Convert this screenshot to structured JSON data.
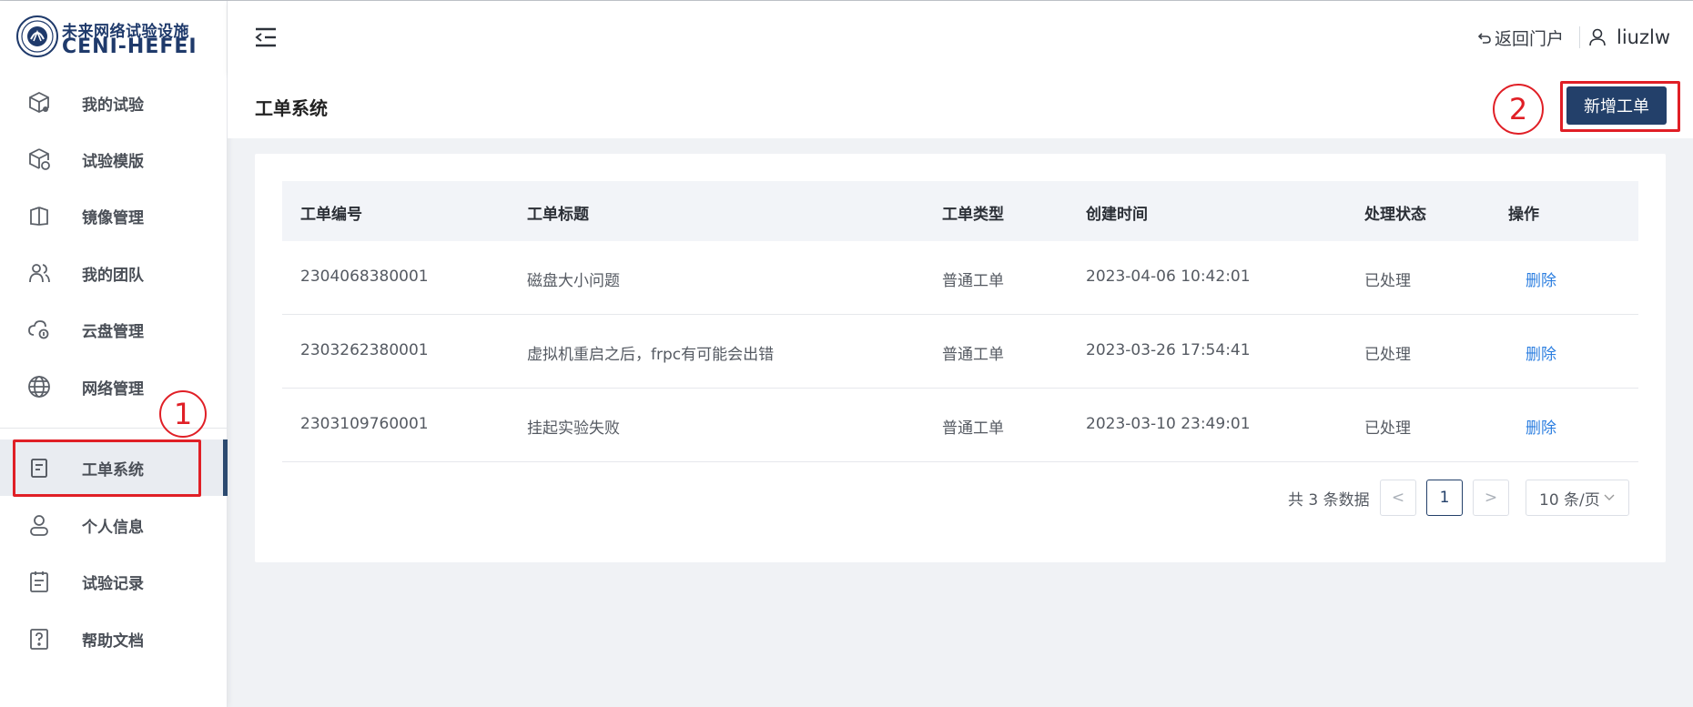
{
  "logo": {
    "name_cn": "未来网络试验设施",
    "name_en": "CENI-HEFEI"
  },
  "sidebar": {
    "items": [
      {
        "label": "我的试验",
        "icon": "cube-box-icon"
      },
      {
        "label": "试验模版",
        "icon": "cube-template-icon"
      },
      {
        "label": "镜像管理",
        "icon": "mirror-book-icon"
      },
      {
        "label": "我的团队",
        "icon": "team-icon"
      },
      {
        "label": "云盘管理",
        "icon": "cloud-disk-icon"
      },
      {
        "label": "网络管理",
        "icon": "globe-icon"
      },
      {
        "label": "工单系统",
        "icon": "ticket-doc-icon",
        "active": true
      },
      {
        "label": "个人信息",
        "icon": "user-icon"
      },
      {
        "label": "试验记录",
        "icon": "clipboard-icon"
      },
      {
        "label": "帮助文档",
        "icon": "help-doc-icon"
      }
    ]
  },
  "header": {
    "back_portal": "返回门户",
    "username": "liuzlw"
  },
  "page": {
    "title": "工单系统",
    "new_button": "新增工单"
  },
  "table": {
    "columns": [
      "工单编号",
      "工单标题",
      "工单类型",
      "创建时间",
      "处理状态",
      "操作"
    ],
    "rows": [
      {
        "id": "2304068380001",
        "title": "磁盘大小问题",
        "type": "普通工单",
        "created": "2023-04-06 10:42:01",
        "status": "已处理",
        "action": "删除"
      },
      {
        "id": "2303262380001",
        "title": "虚拟机重启之后，frpc有可能会出错",
        "type": "普通工单",
        "created": "2023-03-26 17:54:41",
        "status": "已处理",
        "action": "删除"
      },
      {
        "id": "2303109760001",
        "title": "挂起实验失败",
        "type": "普通工单",
        "created": "2023-03-10 23:49:01",
        "status": "已处理",
        "action": "删除"
      }
    ]
  },
  "pagination": {
    "total_text": "共 3 条数据",
    "prev": "<",
    "current_page": "1",
    "next": ">",
    "page_size": "10 条/页"
  },
  "annotations": {
    "marker_1": "1",
    "marker_2": "2"
  },
  "colors": {
    "brand": "#23406a",
    "link": "#2d7fe0",
    "annotation": "#e01f26",
    "background": "#f0f2f5"
  }
}
